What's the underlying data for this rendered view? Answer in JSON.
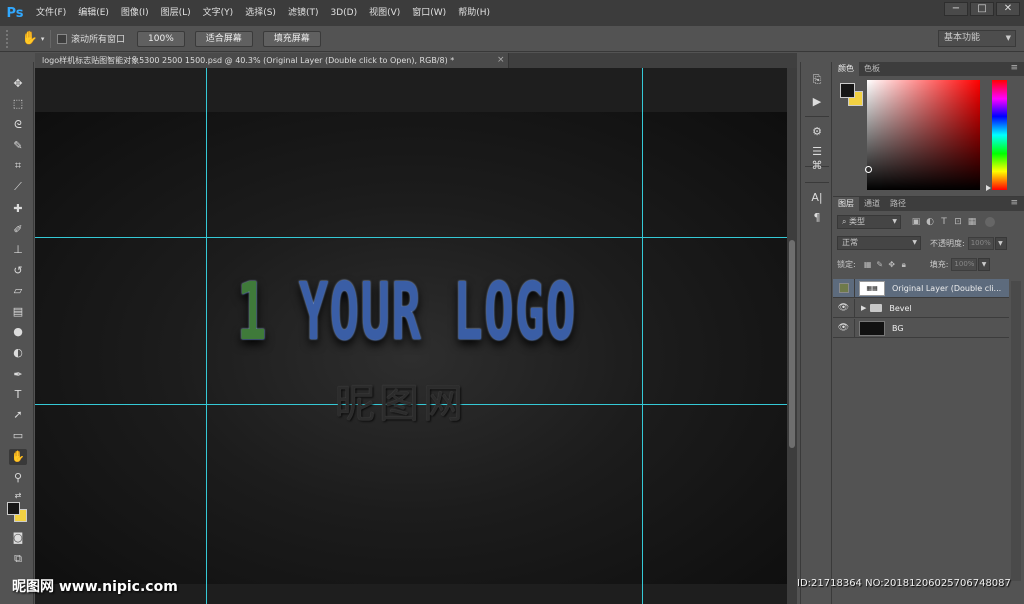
{
  "app": {
    "logo": "Ps"
  },
  "menu": [
    "文件(F)",
    "编辑(E)",
    "图像(I)",
    "图层(L)",
    "文字(Y)",
    "选择(S)",
    "滤镜(T)",
    "3D(D)",
    "视图(V)",
    "窗口(W)",
    "帮助(H)"
  ],
  "window_controls": {
    "minimize": "−",
    "maximize": "□",
    "close": "✕"
  },
  "options_bar": {
    "tool_icon": "hand-icon",
    "scroll_all_label": "滚动所有窗口",
    "zoom_100_label": "100%",
    "fit_screen_label": "适合屏幕",
    "fill_screen_label": "填充屏幕",
    "workspace": "基本功能"
  },
  "document": {
    "tab_title": "logo样机标志贴图智能对象5300 2500 1500.psd @ 40.3% (Original Layer (Double click to Open), RGB/8) *",
    "close": "×",
    "logo_digit": "1",
    "logo_text": " YOUR LOGO",
    "logo_subtext": "昵图网"
  },
  "color_panel": {
    "tabs": [
      "颜色",
      "色板"
    ],
    "foreground": "#161616",
    "background": "#f2d142"
  },
  "layers_panel": {
    "tabs": [
      "图层",
      "通道",
      "路径"
    ],
    "filter_label": "类型",
    "blend_mode": "正常",
    "opacity_label": "不透明度:",
    "opacity_value": "100%",
    "lock_label": "锁定:",
    "fill_label": "填充:",
    "fill_value": "100%",
    "layers": [
      {
        "name": "Original Layer (Double cli...",
        "visible": false,
        "selected": true,
        "type": "smart-object"
      },
      {
        "name": "Bevel",
        "visible": true,
        "selected": false,
        "type": "group"
      },
      {
        "name": "BG",
        "visible": true,
        "selected": false,
        "type": "pixel"
      }
    ]
  },
  "watermarks": {
    "left": "昵图网 www.nipic.com",
    "right": "ID:21718364 NO:20181206025706748087"
  }
}
